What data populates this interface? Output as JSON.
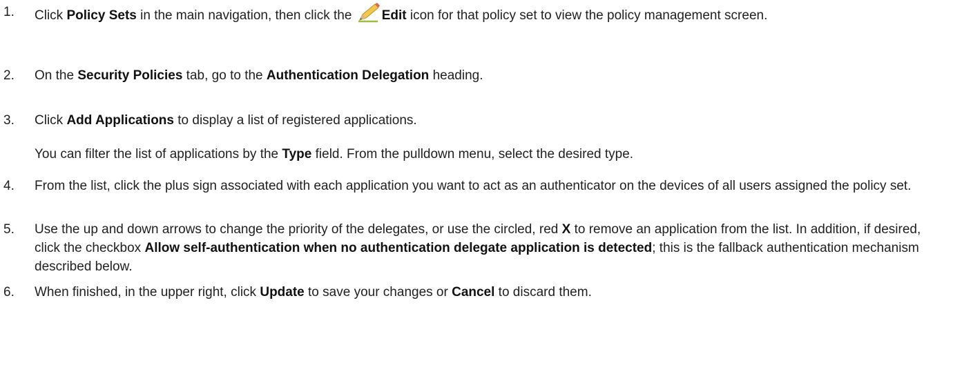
{
  "steps": [
    {
      "number": "1.",
      "parts": [
        "Click ",
        "Policy Sets",
        " in the main navigation, then click the ",
        "Edit",
        " icon for that policy set to view the policy management screen."
      ]
    },
    {
      "number": "2.",
      "parts": [
        "On the ",
        "Security Policies",
        " tab, go to the ",
        "Authentication Delegation",
        " heading."
      ]
    },
    {
      "number": "3.",
      "parts": [
        "Click ",
        "Add Applications",
        " to display a list of registered applications."
      ],
      "note": [
        "You can filter the list of applications by the ",
        "Type",
        " field. From the pulldown menu, select the desired type."
      ]
    },
    {
      "number": "4.",
      "text": "From the list, click the plus sign associated with each application you want to act as an authenticator on the devices of all users assigned the policy set."
    },
    {
      "number": "5.",
      "parts": [
        "Use the up and down arrows to change the priority of the delegates, or use the circled, red ",
        "X",
        " to remove an application from the list. In addition, if desired, click the checkbox ",
        "Allow self-authentication when no authentication delegate application is detected",
        "; this is the fallback authentication mechanism described below."
      ]
    },
    {
      "number": "6.",
      "parts": [
        "When finished, in the upper right, click ",
        "Update",
        " to save your changes or ",
        "Cancel",
        " to discard them."
      ]
    }
  ],
  "icons": {
    "edit": "pencil-icon"
  },
  "colors": {
    "pencil_body": "#f2c84b",
    "pencil_tip": "#d9b48a",
    "pencil_eraser": "#e0625a",
    "underline": "#9bbf3d"
  }
}
